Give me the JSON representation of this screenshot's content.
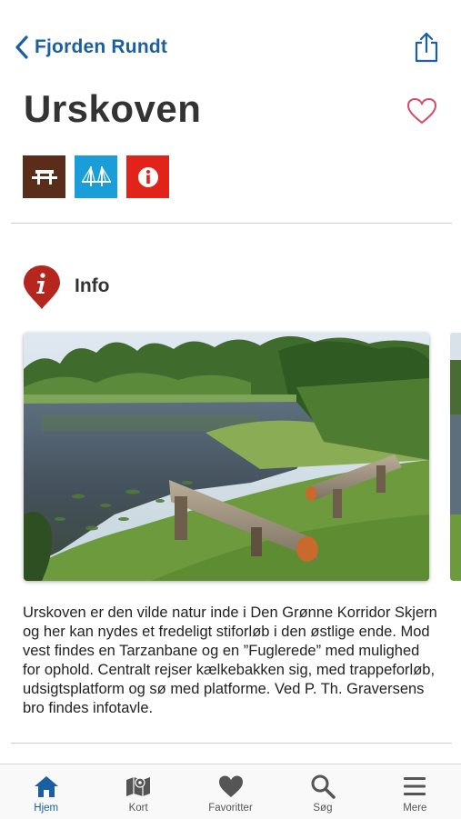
{
  "nav": {
    "back_label": "Fjorden Rundt"
  },
  "page": {
    "title": "Urskoven"
  },
  "badges": [
    {
      "name": "picnic-table-icon",
      "color": "#5a2d1a"
    },
    {
      "name": "bridge-icon",
      "color": "#1a9dd9"
    },
    {
      "name": "info-point-icon",
      "color": "#e2231a"
    }
  ],
  "info": {
    "heading": "Info",
    "description": "Urskoven er den vilde natur inde i Den Grønne Korridor Skjern og her kan nydes et fredeligt stiforløb i den østlige ende. Mod vest findes en Tarzanbane og en ”Fuglerede” med mulighed for ophold. Centralt rejser kælkebakken sig, med trappeforløb, udsigtsplatform og sø med platforme. Ved P. Th. Graversens bro findes infotavle."
  },
  "tabs": [
    {
      "label": "Hjem",
      "icon": "home-icon",
      "active": true
    },
    {
      "label": "Kort",
      "icon": "map-icon",
      "active": false
    },
    {
      "label": "Favoritter",
      "icon": "heart-icon",
      "active": false
    },
    {
      "label": "Søg",
      "icon": "search-icon",
      "active": false
    },
    {
      "label": "Mere",
      "icon": "menu-icon",
      "active": false
    }
  ],
  "colors": {
    "accent": "#1b5fa3",
    "favorite": "#d94a6a",
    "info_pin": "#b5261e",
    "tab_inactive": "#555555"
  }
}
